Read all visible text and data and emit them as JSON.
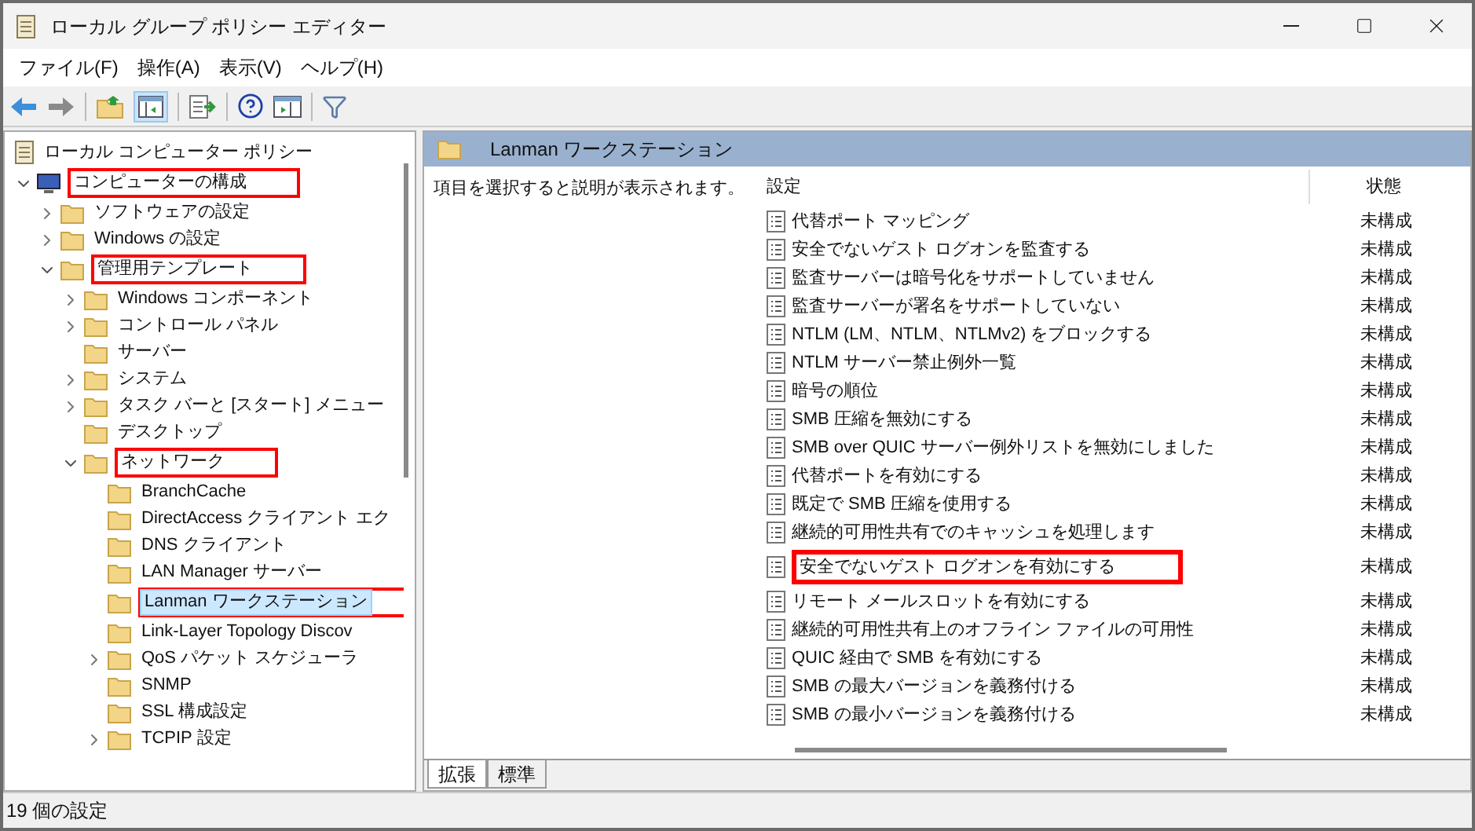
{
  "window": {
    "title": "ローカル グループ ポリシー エディター"
  },
  "menu": [
    "ファイル(F)",
    "操作(A)",
    "表示(V)",
    "ヘルプ(H)"
  ],
  "tree": {
    "root": "ローカル コンピューター ポリシー",
    "items": [
      {
        "label": "コンピューターの構成",
        "expanded": true,
        "selected": false,
        "highlighted": true,
        "children": [
          {
            "label": "ソフトウェアの設定",
            "expanded": false,
            "selected": false,
            "highlighted": false
          },
          {
            "label": "Windows の設定",
            "expanded": false,
            "selected": false,
            "highlighted": false
          },
          {
            "label": "管理用テンプレート",
            "expanded": true,
            "selected": false,
            "highlighted": true,
            "children": [
              {
                "label": "Windows コンポーネント",
                "expanded": false,
                "selected": false,
                "highlighted": false
              },
              {
                "label": "コントロール パネル",
                "expanded": false,
                "selected": false,
                "highlighted": false
              },
              {
                "label": "サーバー",
                "selected": false,
                "highlighted": false
              },
              {
                "label": "システム",
                "expanded": false,
                "selected": false,
                "highlighted": false
              },
              {
                "label": "タスク バーと [スタート] メニュー",
                "expanded": false,
                "selected": false,
                "highlighted": false
              },
              {
                "label": "デスクトップ",
                "selected": false,
                "highlighted": false
              },
              {
                "label": "ネットワーク",
                "expanded": true,
                "selected": false,
                "highlighted": true,
                "children": [
                  {
                    "label": "BranchCache",
                    "selected": false,
                    "highlighted": false
                  },
                  {
                    "label": "DirectAccess クライアント エク",
                    "selected": false,
                    "highlighted": false
                  },
                  {
                    "label": "DNS クライアント",
                    "selected": false,
                    "highlighted": false
                  },
                  {
                    "label": "LAN Manager サーバー",
                    "selected": false,
                    "highlighted": false
                  },
                  {
                    "label": "Lanman ワークステーション",
                    "selected": true,
                    "highlighted": true
                  },
                  {
                    "label": "Link-Layer Topology Discov",
                    "selected": false,
                    "highlighted": false
                  },
                  {
                    "label": "QoS パケット スケジューラ",
                    "expanded": false,
                    "selected": false,
                    "highlighted": false
                  },
                  {
                    "label": "SNMP",
                    "selected": false,
                    "highlighted": false
                  },
                  {
                    "label": "SSL 構成設定",
                    "selected": false,
                    "highlighted": false
                  },
                  {
                    "label": "TCPIP 設定",
                    "expanded": false,
                    "selected": false,
                    "highlighted": false
                  }
                ]
              }
            ]
          }
        ]
      }
    ]
  },
  "pane": {
    "title": "Lanman ワークステーション",
    "description": "項目を選択すると説明が表示されます。",
    "columns": [
      "設定",
      "状態"
    ],
    "rows": [
      {
        "setting": "代替ポート マッピング",
        "state": "未構成",
        "highlighted": false
      },
      {
        "setting": "安全でないゲスト ログオンを監査する",
        "state": "未構成",
        "highlighted": false
      },
      {
        "setting": "監査サーバーは暗号化をサポートしていません",
        "state": "未構成",
        "highlighted": false
      },
      {
        "setting": "監査サーバーが署名をサポートしていない",
        "state": "未構成",
        "highlighted": false
      },
      {
        "setting": "NTLM (LM、NTLM、NTLMv2) をブロックする",
        "state": "未構成",
        "highlighted": false
      },
      {
        "setting": "NTLM サーバー禁止例外一覧",
        "state": "未構成",
        "highlighted": false
      },
      {
        "setting": "暗号の順位",
        "state": "未構成",
        "highlighted": false
      },
      {
        "setting": "SMB 圧縮を無効にする",
        "state": "未構成",
        "highlighted": false
      },
      {
        "setting": "SMB over QUIC サーバー例外リストを無効にしました",
        "state": "未構成",
        "highlighted": false
      },
      {
        "setting": "代替ポートを有効にする",
        "state": "未構成",
        "highlighted": false
      },
      {
        "setting": "既定で SMB 圧縮を使用する",
        "state": "未構成",
        "highlighted": false
      },
      {
        "setting": "継続的可用性共有でのキャッシュを処理します",
        "state": "未構成",
        "highlighted": false
      },
      {
        "setting": "安全でないゲスト ログオンを有効にする",
        "state": "未構成",
        "highlighted": true
      },
      {
        "setting": "リモート メールスロットを有効にする",
        "state": "未構成",
        "highlighted": false
      },
      {
        "setting": "継続的可用性共有上のオフライン ファイルの可用性",
        "state": "未構成",
        "highlighted": false
      },
      {
        "setting": "QUIC 経由で SMB を有効にする",
        "state": "未構成",
        "highlighted": false
      },
      {
        "setting": "SMB の最大バージョンを義務付ける",
        "state": "未構成",
        "highlighted": false
      },
      {
        "setting": "SMB の最小バージョンを義務付ける",
        "state": "未構成",
        "highlighted": false
      }
    ],
    "tabs": [
      {
        "label": "拡張",
        "selected": true
      },
      {
        "label": "標準",
        "selected": false
      }
    ]
  },
  "status_bar": "19 個の設定"
}
